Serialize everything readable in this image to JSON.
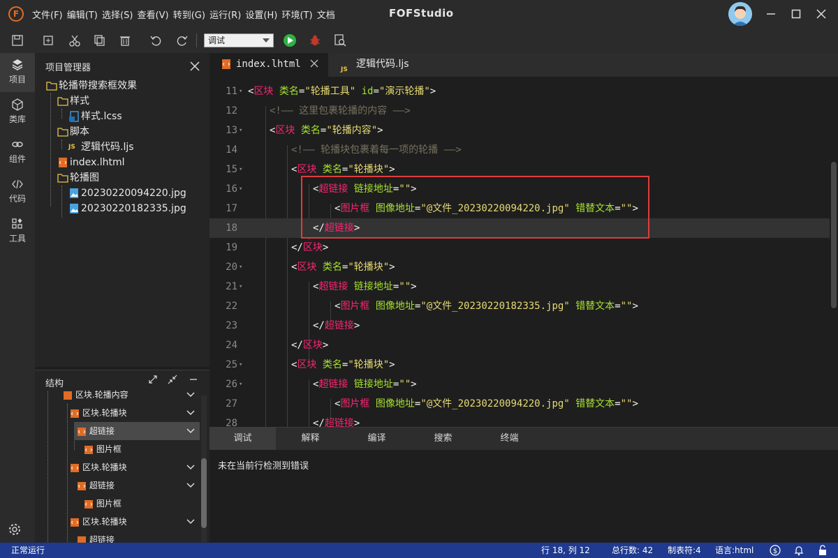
{
  "app": {
    "logo_letter": "F",
    "title": "FOFStudio",
    "menu": [
      "文件(F)",
      "编辑(T)",
      "选择(S)",
      "查看(V)",
      "转到(G)",
      "运行(R)",
      "设置(H)",
      "环境(T)",
      "文档"
    ],
    "window_controls": [
      "minimize",
      "maximize",
      "close"
    ]
  },
  "toolbar": {
    "mode_value": "调试",
    "icons": [
      "save-icon",
      "save-all-icon",
      "cut-icon",
      "copy-icon",
      "delete-icon",
      "undo-icon",
      "redo-icon",
      "run-icon",
      "debug-icon",
      "search-file-icon"
    ]
  },
  "activity": [
    {
      "label": "项目",
      "icon": "layers-icon"
    },
    {
      "label": "类库",
      "icon": "cube-icon"
    },
    {
      "label": "组件",
      "icon": "link-icon"
    },
    {
      "label": "代码",
      "icon": "code-icon"
    },
    {
      "label": "工具",
      "icon": "tools-icon"
    }
  ],
  "project": {
    "title": "项目管理器",
    "tree": [
      {
        "label": "轮播带搜索框效果",
        "type": "folder"
      },
      {
        "label": "样式",
        "type": "folder"
      },
      {
        "label": "样式.lcss",
        "type": "css-file"
      },
      {
        "label": "脚本",
        "type": "folder"
      },
      {
        "label": "逻辑代码.ljs",
        "type": "js-file"
      },
      {
        "label": "index.lhtml",
        "type": "html-file"
      },
      {
        "label": "轮播图",
        "type": "folder"
      },
      {
        "label": "20230220094220.jpg",
        "type": "image-file"
      },
      {
        "label": "20230220182335.jpg",
        "type": "image-file"
      }
    ]
  },
  "structure": {
    "title": "结构",
    "rows": [
      {
        "label": "区块.轮播内容"
      },
      {
        "label": "区块.轮播块"
      },
      {
        "label": "超链接"
      },
      {
        "label": "图片框"
      },
      {
        "label": "区块.轮播块"
      },
      {
        "label": "超链接"
      },
      {
        "label": "图片框"
      },
      {
        "label": "区块.轮播块"
      },
      {
        "label": "超链接"
      }
    ]
  },
  "tabs": [
    {
      "label": "index.lhtml",
      "active": true
    },
    {
      "label": "逻辑代码.ljs",
      "active": false
    }
  ],
  "editor": {
    "current_line": 18,
    "lines": [
      {
        "n": "11",
        "fold": true,
        "indent": 0,
        "tokens": [
          [
            "br",
            "<"
          ],
          [
            "tag",
            "区块"
          ],
          [
            "br",
            " "
          ],
          [
            "attr",
            "类名"
          ],
          [
            "br",
            "="
          ],
          [
            "str",
            "\"轮播工具\""
          ],
          [
            "br",
            " "
          ],
          [
            "attr",
            "id"
          ],
          [
            "br",
            "="
          ],
          [
            "str",
            "\"演示轮播\""
          ],
          [
            "br",
            ">"
          ]
        ]
      },
      {
        "n": "12",
        "fold": false,
        "indent": 1,
        "tokens": [
          [
            "com",
            "<!—— 这里包裹轮播的内容 ——>"
          ]
        ]
      },
      {
        "n": "13",
        "fold": true,
        "indent": 1,
        "tokens": [
          [
            "br",
            "<"
          ],
          [
            "tag",
            "区块"
          ],
          [
            "br",
            " "
          ],
          [
            "attr",
            "类名"
          ],
          [
            "br",
            "="
          ],
          [
            "str",
            "\"轮播内容\""
          ],
          [
            "br",
            ">"
          ]
        ]
      },
      {
        "n": "14",
        "fold": false,
        "indent": 2,
        "tokens": [
          [
            "com",
            "<!—— 轮播块包裹着每一项的轮播 ——>"
          ]
        ]
      },
      {
        "n": "15",
        "fold": true,
        "indent": 2,
        "tokens": [
          [
            "br",
            "<"
          ],
          [
            "tag",
            "区块"
          ],
          [
            "br",
            " "
          ],
          [
            "attr",
            "类名"
          ],
          [
            "br",
            "="
          ],
          [
            "str",
            "\"轮播块\""
          ],
          [
            "br",
            ">"
          ]
        ]
      },
      {
        "n": "16",
        "fold": true,
        "indent": 3,
        "tokens": [
          [
            "br",
            "<"
          ],
          [
            "tag",
            "超链接"
          ],
          [
            "br",
            " "
          ],
          [
            "attr",
            "链接地址"
          ],
          [
            "br",
            "="
          ],
          [
            "str",
            "\"\""
          ],
          [
            "br",
            ">"
          ]
        ]
      },
      {
        "n": "17",
        "fold": false,
        "indent": 4,
        "tokens": [
          [
            "br",
            "<"
          ],
          [
            "tag",
            "图片框"
          ],
          [
            "br",
            " "
          ],
          [
            "attr",
            "图像地址"
          ],
          [
            "br",
            "="
          ],
          [
            "str",
            "\"@文件_20230220094220.jpg\""
          ],
          [
            "br",
            " "
          ],
          [
            "attr",
            "错替文本"
          ],
          [
            "br",
            "="
          ],
          [
            "str",
            "\"\""
          ],
          [
            "br",
            ">"
          ]
        ]
      },
      {
        "n": "18",
        "fold": false,
        "indent": 3,
        "tokens": [
          [
            "br",
            "</"
          ],
          [
            "tag",
            "超链接"
          ],
          [
            "br",
            ">"
          ]
        ]
      },
      {
        "n": "19",
        "fold": false,
        "indent": 2,
        "tokens": [
          [
            "br",
            "</"
          ],
          [
            "tag",
            "区块"
          ],
          [
            "br",
            ">"
          ]
        ]
      },
      {
        "n": "20",
        "fold": true,
        "indent": 2,
        "tokens": [
          [
            "br",
            "<"
          ],
          [
            "tag",
            "区块"
          ],
          [
            "br",
            " "
          ],
          [
            "attr",
            "类名"
          ],
          [
            "br",
            "="
          ],
          [
            "str",
            "\"轮播块\""
          ],
          [
            "br",
            ">"
          ]
        ]
      },
      {
        "n": "21",
        "fold": true,
        "indent": 3,
        "tokens": [
          [
            "br",
            "<"
          ],
          [
            "tag",
            "超链接"
          ],
          [
            "br",
            " "
          ],
          [
            "attr",
            "链接地址"
          ],
          [
            "br",
            "="
          ],
          [
            "str",
            "\"\""
          ],
          [
            "br",
            ">"
          ]
        ]
      },
      {
        "n": "22",
        "fold": false,
        "indent": 4,
        "tokens": [
          [
            "br",
            "<"
          ],
          [
            "tag",
            "图片框"
          ],
          [
            "br",
            " "
          ],
          [
            "attr",
            "图像地址"
          ],
          [
            "br",
            "="
          ],
          [
            "str",
            "\"@文件_20230220182335.jpg\""
          ],
          [
            "br",
            " "
          ],
          [
            "attr",
            "错替文本"
          ],
          [
            "br",
            "="
          ],
          [
            "str",
            "\"\""
          ],
          [
            "br",
            ">"
          ]
        ]
      },
      {
        "n": "23",
        "fold": false,
        "indent": 3,
        "tokens": [
          [
            "br",
            "</"
          ],
          [
            "tag",
            "超链接"
          ],
          [
            "br",
            ">"
          ]
        ]
      },
      {
        "n": "24",
        "fold": false,
        "indent": 2,
        "tokens": [
          [
            "br",
            "</"
          ],
          [
            "tag",
            "区块"
          ],
          [
            "br",
            ">"
          ]
        ]
      },
      {
        "n": "25",
        "fold": true,
        "indent": 2,
        "tokens": [
          [
            "br",
            "<"
          ],
          [
            "tag",
            "区块"
          ],
          [
            "br",
            " "
          ],
          [
            "attr",
            "类名"
          ],
          [
            "br",
            "="
          ],
          [
            "str",
            "\"轮播块\""
          ],
          [
            "br",
            ">"
          ]
        ]
      },
      {
        "n": "26",
        "fold": true,
        "indent": 3,
        "tokens": [
          [
            "br",
            "<"
          ],
          [
            "tag",
            "超链接"
          ],
          [
            "br",
            " "
          ],
          [
            "attr",
            "链接地址"
          ],
          [
            "br",
            "="
          ],
          [
            "str",
            "\"\""
          ],
          [
            "br",
            ">"
          ]
        ]
      },
      {
        "n": "27",
        "fold": false,
        "indent": 4,
        "tokens": [
          [
            "br",
            "<"
          ],
          [
            "tag",
            "图片框"
          ],
          [
            "br",
            " "
          ],
          [
            "attr",
            "图像地址"
          ],
          [
            "br",
            "="
          ],
          [
            "str",
            "\"@文件_20230220094220.jpg\""
          ],
          [
            "br",
            " "
          ],
          [
            "attr",
            "错替文本"
          ],
          [
            "br",
            "="
          ],
          [
            "str",
            "\"\""
          ],
          [
            "br",
            ">"
          ]
        ]
      },
      {
        "n": "28",
        "fold": false,
        "indent": 3,
        "tokens": [
          [
            "br",
            "</"
          ],
          [
            "tag",
            "超链接"
          ],
          [
            "br",
            ">"
          ]
        ]
      }
    ]
  },
  "bottom_panel": {
    "tabs": [
      "调试",
      "解释",
      "编译",
      "搜索",
      "终端"
    ],
    "active_tab": "调试",
    "message": "未在当前行检测到错误"
  },
  "status": {
    "left": "正常运行",
    "position": "行 18, 列 12",
    "total_lines": "总行数: 42",
    "tab_size": "制表符:4",
    "language": "语言:html"
  },
  "colors": {
    "tag": "#f92672",
    "attr": "#a6e22e",
    "string": "#e6db74",
    "comment": "#75715e",
    "status_bar": "#1f3a8f",
    "highlight_box": "#e03c3c"
  }
}
